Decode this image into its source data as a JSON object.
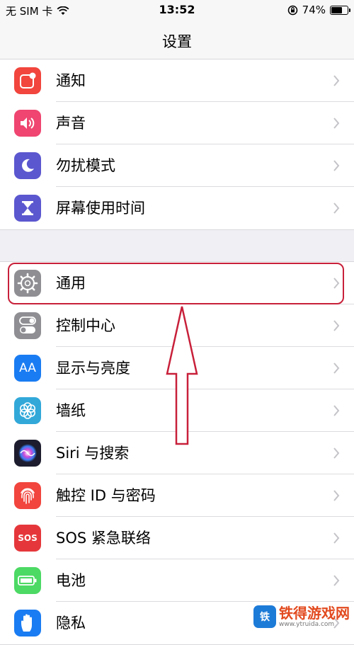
{
  "status_bar": {
    "carrier": "无 SIM 卡",
    "time": "13:52",
    "battery_percent": "74%",
    "battery_level": 0.74,
    "icons": [
      "wifi-icon",
      "rotation-lock-icon",
      "battery-icon"
    ]
  },
  "nav": {
    "title": "设置"
  },
  "group1": [
    {
      "label": "通知",
      "icon": "notification-icon",
      "color": "#f1453d"
    },
    {
      "label": "声音",
      "icon": "sound-icon",
      "color": "#ef4570"
    },
    {
      "label": "勿扰模式",
      "icon": "moon-icon",
      "color": "#5b57cf"
    },
    {
      "label": "屏幕使用时间",
      "icon": "hourglass-icon",
      "color": "#5b57cf"
    }
  ],
  "group2": [
    {
      "label": "通用",
      "icon": "gear-icon",
      "color": "#8e8e93"
    },
    {
      "label": "控制中心",
      "icon": "toggle-icon",
      "color": "#8e8e93"
    },
    {
      "label": "显示与亮度",
      "icon": "text-size-icon",
      "color": "#1a7cf2",
      "glyph": "AA"
    },
    {
      "label": "墙纸",
      "icon": "flower-icon",
      "color": "#32a8d9"
    },
    {
      "label": "Siri 与搜索",
      "icon": "siri-icon",
      "color": "#1c1c2e"
    },
    {
      "label": "触控 ID 与密码",
      "icon": "fingerprint-icon",
      "color": "#f1453d"
    },
    {
      "label": "SOS 紧急联络",
      "icon": "sos-icon",
      "color": "#e5373b",
      "glyph": "SOS"
    },
    {
      "label": "电池",
      "icon": "battery-icon",
      "color": "#4cd964"
    },
    {
      "label": "隐私",
      "icon": "hand-icon",
      "color": "#1a7cf2"
    }
  ],
  "watermark": {
    "title": "铁得游戏网",
    "url": "www.ytruida.com",
    "logo_glyph": "铁"
  }
}
